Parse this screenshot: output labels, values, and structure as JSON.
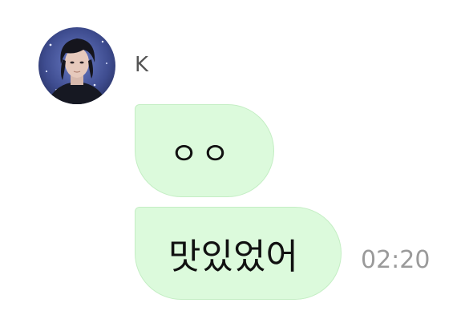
{
  "contact": {
    "name": "K",
    "avatar_icon": "profile-photo"
  },
  "messages": [
    {
      "text": "ㅇㅇ"
    },
    {
      "text": "맛있었어",
      "time": "02:20"
    }
  ],
  "colors": {
    "bubble_bg": "#dcfadc",
    "bubble_border": "#c4eec4",
    "timestamp": "#9a9a9a",
    "name": "#555555"
  }
}
